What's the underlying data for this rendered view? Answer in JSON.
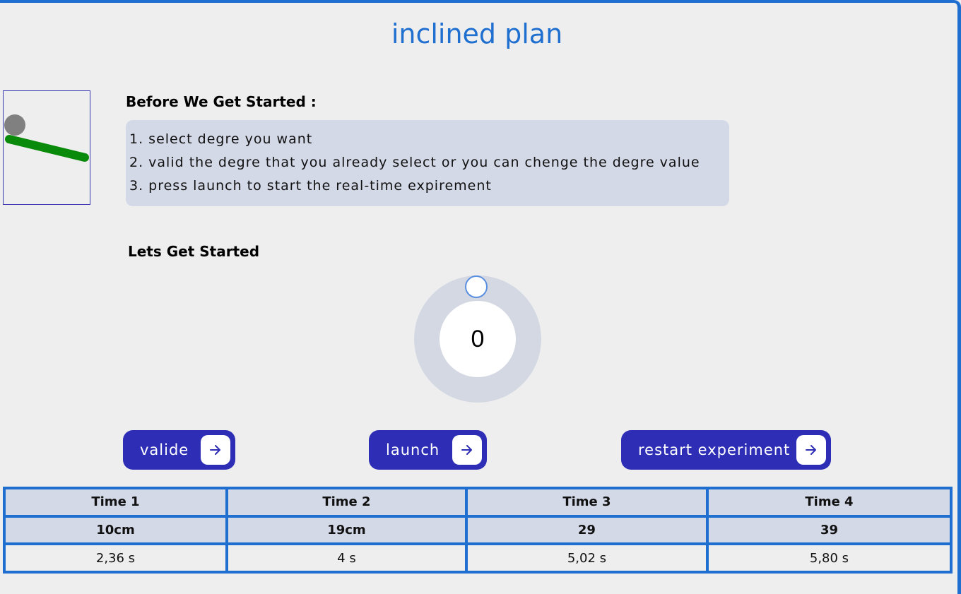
{
  "title": "inclined plan",
  "before": {
    "heading": "Before We Get Started :",
    "steps": [
      "1. select degre you want",
      "2. valid the degre that you already select or you can chenge the degre value",
      "3. press launch to start the real-time expirement"
    ]
  },
  "start": {
    "heading": "Lets Get Started"
  },
  "dial": {
    "value": "0"
  },
  "buttons": {
    "valide": "valide",
    "launch": "launch",
    "restart": "restart experiment"
  },
  "table": {
    "headers": [
      "Time 1",
      "Time 2",
      "Time 3",
      "Time 4"
    ],
    "distances": [
      "10cm",
      "19cm",
      "29",
      "39"
    ],
    "times": [
      "2,36 s",
      "4 s",
      "5,02 s",
      "5,80 s"
    ]
  },
  "colors": {
    "accent": "#1f6fd0",
    "button": "#2d2db5",
    "panel": "#d4d9e8",
    "ramp": "#0a8a0a",
    "ball": "#808080"
  },
  "icons": {
    "button_arrow": "arrow-right-icon"
  }
}
